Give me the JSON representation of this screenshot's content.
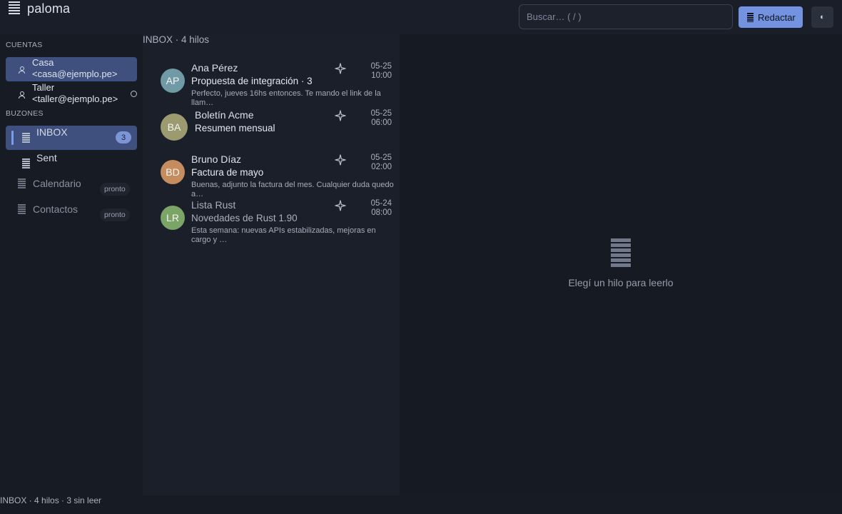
{
  "app": {
    "name": "paloma",
    "icon": "stack-icon"
  },
  "header": {
    "search_placeholder": "Buscar… ( / )",
    "compose_label": "Redactar",
    "theme_label": "◐"
  },
  "sidebar": {
    "accounts_title": "CUENTAS",
    "accounts": [
      {
        "name": "Casa",
        "email": "<casa@ejemplo.pe>",
        "active": true
      },
      {
        "name": "Taller",
        "email": "<taller@ejemplo.pe>",
        "active": false
      }
    ],
    "mailboxes_title": "BUZONES",
    "mailboxes": [
      {
        "label": "INBOX",
        "count": "3",
        "active": true
      },
      {
        "label": "Sent"
      },
      {
        "label": "Calendario",
        "badge": "pronto"
      },
      {
        "label": "Contactos",
        "badge": "pronto"
      }
    ]
  },
  "threads": {
    "header": "INBOX  ·  4 hilos",
    "items": [
      {
        "initials": "AP",
        "avatar_color": "#6f9aa6",
        "from": "Ana Pérez",
        "subject": "Propuesta de integración  ·  3",
        "snippet": "Perfecto, jueves 16hs entonces. Te mando el link de la llam…",
        "date": "05-25\n10:00"
      },
      {
        "initials": "BA",
        "avatar_color": "#9b9b6f",
        "from": "Boletín Acme",
        "subject": "Resumen mensual",
        "snippet": "",
        "date": "05-25\n06:00"
      },
      {
        "initials": "BD",
        "avatar_color": "#c58c5e",
        "from": "Bruno Díaz",
        "subject": "Factura de mayo",
        "snippet": "Buenas, adjunto la factura del mes. Cualquier duda quedo a…",
        "date": "05-25\n02:00"
      },
      {
        "initials": "LR",
        "avatar_color": "#7ba566",
        "from": "Lista Rust",
        "subject": "Novedades de Rust 1.90",
        "snippet": "Esta semana: nuevas APIs estabilizadas, mejoras en cargo y …",
        "date": "05-24\n08:00"
      }
    ]
  },
  "reader": {
    "empty_text": "Elegí un hilo para leerlo"
  },
  "status": {
    "text": "INBOX · 4 hilos · 3 sin leer"
  }
}
